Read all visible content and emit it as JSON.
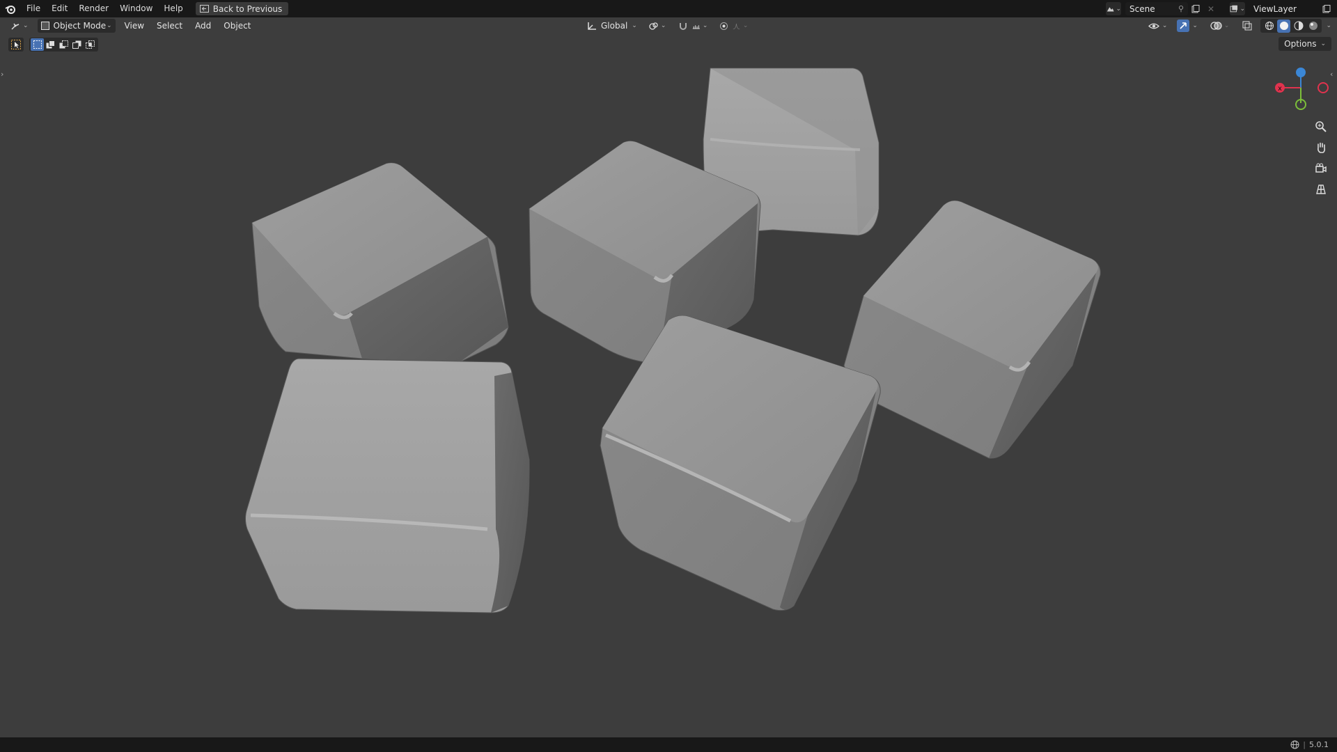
{
  "menubar": {
    "items": [
      "File",
      "Edit",
      "Render",
      "Window",
      "Help"
    ],
    "back_label": "Back to Previous",
    "scene_name": "Scene",
    "view_layer": "ViewLayer"
  },
  "viewport_header": {
    "mode": "Object Mode",
    "menus": [
      "View",
      "Select",
      "Add",
      "Object"
    ],
    "transform_orientation": "Global"
  },
  "options_label": "Options",
  "status": {
    "version": "5.0.1"
  },
  "colors": {
    "viewport_bg": "#3d3d3d",
    "header_bg": "#181818",
    "accent": "#4772b3",
    "axis_x": "#e0334e",
    "axis_y": "#7cbf3a",
    "axis_z": "#3b87d6"
  }
}
